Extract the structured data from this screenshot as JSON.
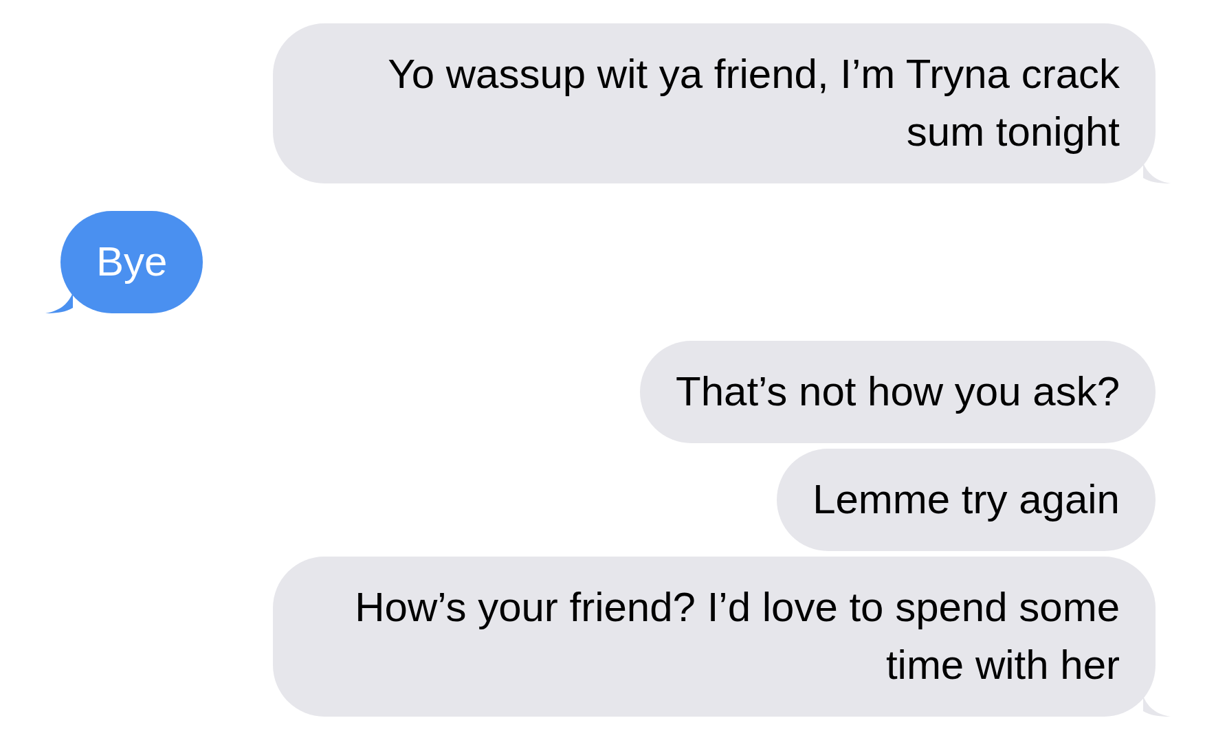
{
  "messages": [
    {
      "kind": "received",
      "text": "Yo wassup wit ya friend, I’m Tryna crack sum tonight",
      "tail": true
    },
    {
      "kind": "sent",
      "text": "Bye",
      "tail": true
    },
    {
      "kind": "received",
      "text": "That’s not how you ask?",
      "tail": false
    },
    {
      "kind": "received",
      "text": "Lemme try again",
      "tail": false
    },
    {
      "kind": "received",
      "text": "How’s your friend? I’d love to spend some time with her",
      "tail": true
    }
  ]
}
